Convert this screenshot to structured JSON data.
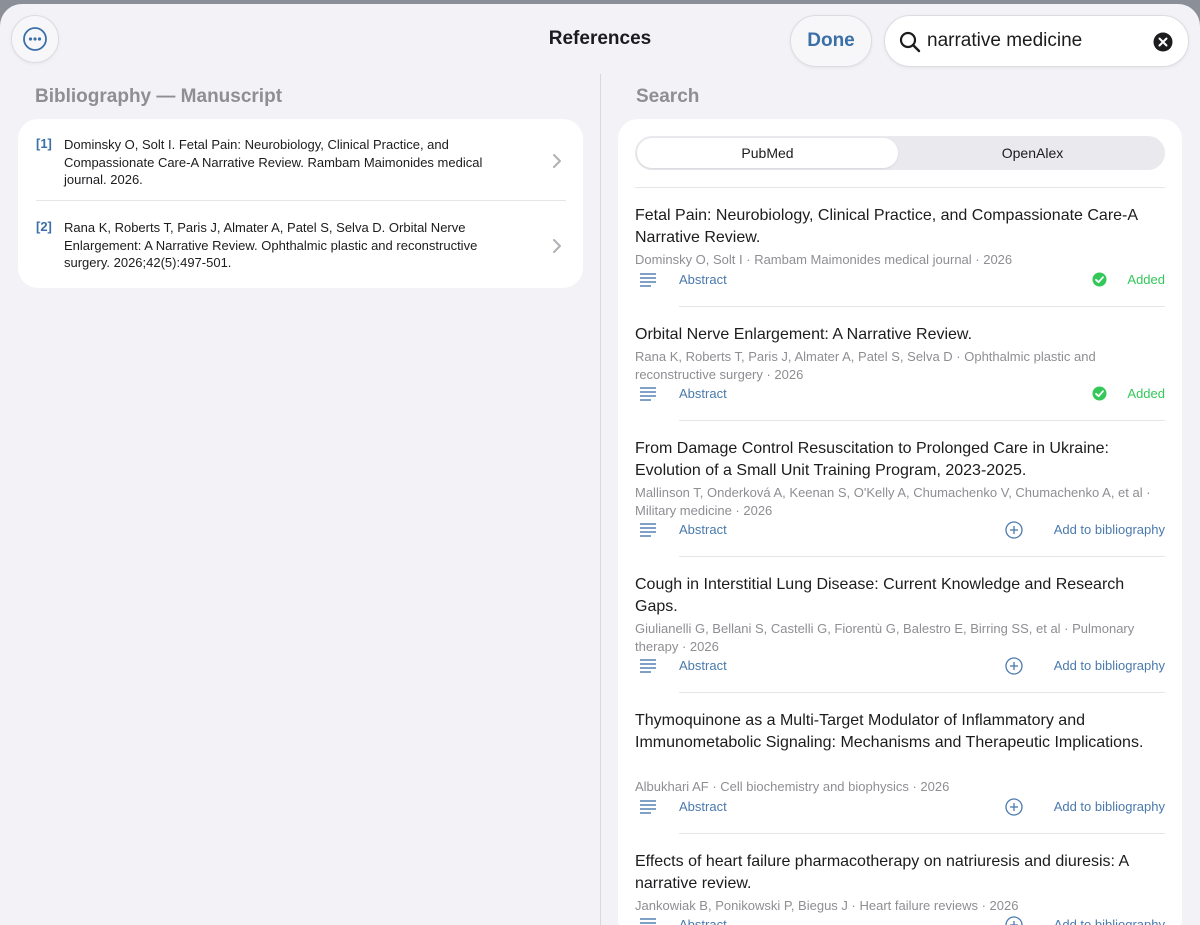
{
  "header": {
    "title": "References",
    "done_label": "Done",
    "search_value": "narrative medicine"
  },
  "bibliography": {
    "heading": "Bibliography — Manuscript",
    "items": [
      {
        "num": "[1]",
        "text": "Dominsky O, Solt I. Fetal Pain: Neurobiology, Clinical Practice, and Compassionate Care-A Narrative Review. Rambam Maimonides medical journal. 2026."
      },
      {
        "num": "[2]",
        "text": "Rana K, Roberts T, Paris J, Almater A, Patel S, Selva D. Orbital Nerve Enlargement: A Narrative Review. Ophthalmic plastic and reconstructive surgery. 2026;42(5):497-501."
      }
    ]
  },
  "search": {
    "heading": "Search",
    "tabs": [
      {
        "label": "PubMed",
        "active": true
      },
      {
        "label": "OpenAlex",
        "active": false
      }
    ],
    "abstract_label": "Abstract",
    "added_label": "Added",
    "add_label": "Add to bibliography",
    "results": [
      {
        "title": "Fetal Pain: Neurobiology, Clinical Practice, and Compassionate Care-A Narrative Review.",
        "meta": "Dominsky O, Solt I · Rambam Maimonides medical journal · 2026",
        "status": "added"
      },
      {
        "title": "Orbital Nerve Enlargement: A Narrative Review.",
        "meta": "Rana K, Roberts T, Paris J, Almater A, Patel S, Selva D · Ophthalmic plastic and reconstructive surgery · 2026",
        "status": "added"
      },
      {
        "title": "From Damage Control Resuscitation to Prolonged Care in Ukraine: Evolution of a Small Unit Training Program, 2023-2025.",
        "meta": "Mallinson T, Onderková A, Keenan S, O'Kelly A, Chumachenko V, Chumachenko A, et al · Military medicine · 2026",
        "status": "add"
      },
      {
        "title": "Cough in Interstitial Lung Disease: Current Knowledge and Research Gaps.",
        "meta": "Giulianelli G, Bellani S, Castelli G, Fiorentù G, Balestro E, Birring SS, et al · Pulmonary therapy · 2026",
        "status": "add"
      },
      {
        "title": "Thymoquinone as a Multi-Target Modulator of Inflammatory and Immunometabolic Signaling: Mechanisms and Therapeutic Implications.",
        "meta": "Albukhari AF · Cell biochemistry and biophysics · 2026",
        "status": "add"
      },
      {
        "title": "Effects of heart failure pharmacotherapy on natriuresis and diuresis: A narrative review.",
        "meta": "Jankowiak B, Ponikowski P, Biegus J · Heart failure reviews · 2026",
        "status": "add"
      }
    ]
  }
}
